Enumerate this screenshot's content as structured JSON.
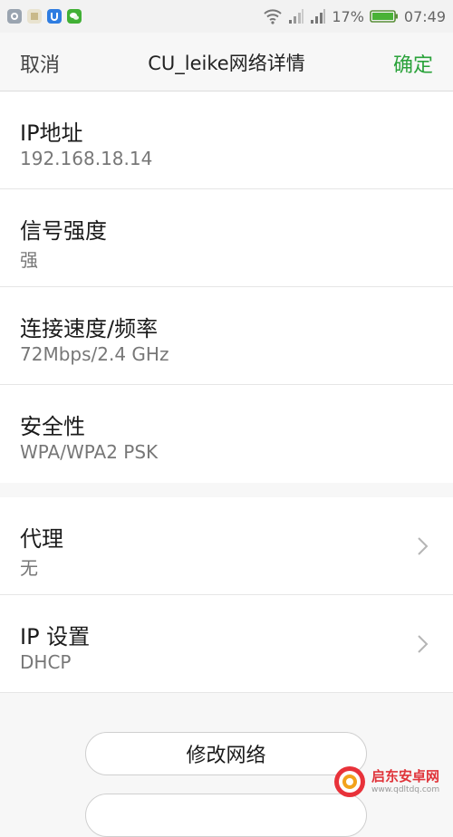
{
  "status_bar": {
    "battery_percent": "17%",
    "time": "07:49",
    "icons": [
      "qq-icon",
      "notification-icon",
      "app-u-icon",
      "wechat-icon",
      "wifi-icon",
      "signal-icon",
      "signal-icon",
      "battery-icon"
    ]
  },
  "header": {
    "cancel_label": "取消",
    "title": "CU_leike网络详情",
    "confirm_label": "确定",
    "confirm_color": "#2aa23a"
  },
  "details": [
    {
      "label": "IP地址",
      "value": "192.168.18.14"
    },
    {
      "label": "信号强度",
      "value": "强"
    },
    {
      "label": "连接速度/频率",
      "value": "72Mbps/2.4 GHz"
    },
    {
      "label": "安全性",
      "value": "WPA/WPA2 PSK"
    }
  ],
  "settings": [
    {
      "label": "代理",
      "value": "无"
    },
    {
      "label": "IP 设置",
      "value": "DHCP"
    }
  ],
  "actions": {
    "modify_network_label": "修改网络"
  },
  "watermark": {
    "name": "启东安卓网",
    "url": "www.qdltdq.com"
  }
}
